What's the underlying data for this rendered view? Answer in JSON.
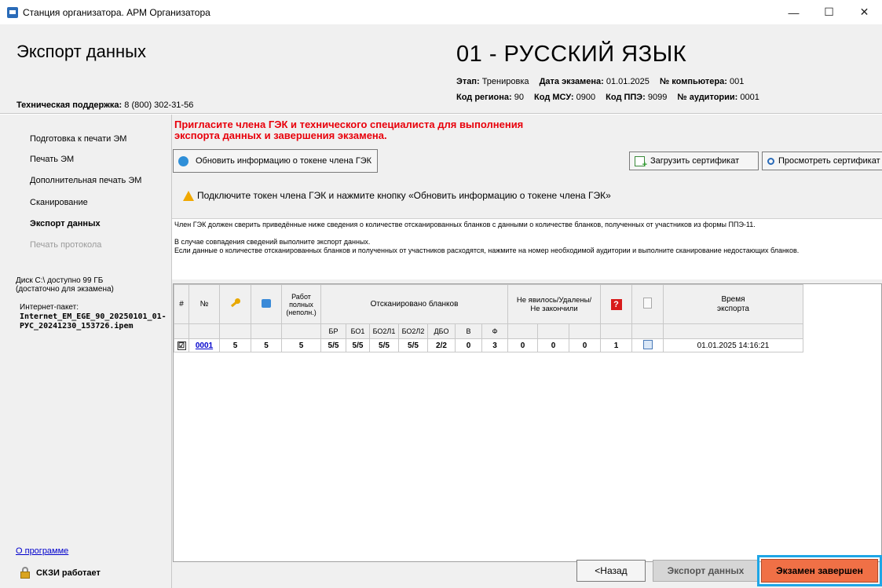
{
  "window": {
    "title": "Станция организатора. АРМ Организатора",
    "minimize": "—",
    "maximize": "☐",
    "close": "✕"
  },
  "header": {
    "page_title": "Экспорт данных",
    "support_label": "Техническая поддержка:",
    "support_phone": "8 (800) 302-31-56",
    "subject": "01 - РУССКИЙ ЯЗЫК",
    "stage_label": "Этап:",
    "stage_value": "Тренировка",
    "exam_date_label": "Дата экзамена:",
    "exam_date_value": "01.01.2025",
    "computer_label": "№ компьютера:",
    "computer_value": "001",
    "region_label": "Код региона:",
    "region_value": "90",
    "msu_label": "Код МСУ:",
    "msu_value": "0900",
    "ppe_label": "Код ППЭ:",
    "ppe_value": "9099",
    "auditorium_label": "№ аудитории:",
    "auditorium_value": "0001"
  },
  "sidebar": {
    "items": [
      {
        "label": "Подготовка к печати ЭМ",
        "state": "normal"
      },
      {
        "label": "Печать ЭМ",
        "state": "normal"
      },
      {
        "label": "Дополнительная печать ЭМ",
        "state": "normal"
      },
      {
        "label": "Сканирование",
        "state": "normal"
      },
      {
        "label": "Экспорт данных",
        "state": "active"
      },
      {
        "label": "Печать протокола",
        "state": "disabled"
      }
    ],
    "disk_line1": "Диск С:\\ доступно 99 ГБ",
    "disk_line2": "(достаточно для экзамена)",
    "internet_label": "Интернет-пакет:",
    "internet_file": "Internet_EM_EGE_90_20250101_01-РУС_20241230_153726.ipem",
    "about_link": "О программе",
    "skzi_status": "СКЗИ работает"
  },
  "main": {
    "warning_line1": "Пригласите члена ГЭК и технического специалиста для выполнения",
    "warning_line2": "экспорта данных и завершения экзамена.",
    "refresh_button": "Обновить информацию о токене члена ГЭК",
    "load_cert_button": "Загрузить сертификат",
    "view_cert_button": "Просмотреть сертификат",
    "token_warning": "Подключите токен члена ГЭК и нажмите кнопку «Обновить информацию о токене члена ГЭК»",
    "instruction1": "Член ГЭК должен сверить приведённые ниже сведения о количестве отсканированных бланков с данными о количестве бланков, полученных от участников из формы ППЭ-11.",
    "instruction2": "В случае совпадения сведений выполните экспорт данных.",
    "instruction3": "Если данные о количестве отсканированных бланков и полученных от участников расходятся, нажмите на номер необходимой аудитории и выполните сканирование недостающих бланков."
  },
  "table": {
    "headers": {
      "hash": "#",
      "number": "№",
      "works_line1": "Работ",
      "works_line2": "полных",
      "works_line3": "(неполн.)",
      "scanned": "Отсканировано бланков",
      "absent_line1": "Не явилось/Удалены/",
      "absent_line2": "Не закончили",
      "time_line1": "Время",
      "time_line2": "экспорта"
    },
    "subheaders": [
      "БР",
      "БО1",
      "БО2Л1",
      "БО2Л2",
      "ДБО",
      "В",
      "Ф"
    ],
    "rows": [
      {
        "checked": "☑",
        "number": "0001",
        "key": "5",
        "print": "5",
        "works": "5",
        "br": "5/5",
        "bo1": "5/5",
        "bo2l1": "5/5",
        "bo2l2": "5/5",
        "dbo": "2/2",
        "v": "0",
        "f": "3",
        "absent": "0",
        "removed": "0",
        "not_finished": "0",
        "errors": "1",
        "export_time": "01.01.2025 14:16:21"
      }
    ]
  },
  "footer": {
    "back_button": "<Назад",
    "export_button": "Экспорт данных",
    "finish_button": "Экзамен завершен"
  },
  "colors": {
    "warning_red": "#e8000b",
    "finish_orange": "#f07046",
    "focus_blue": "#1ea6e6",
    "link_blue": "#0000cc"
  }
}
